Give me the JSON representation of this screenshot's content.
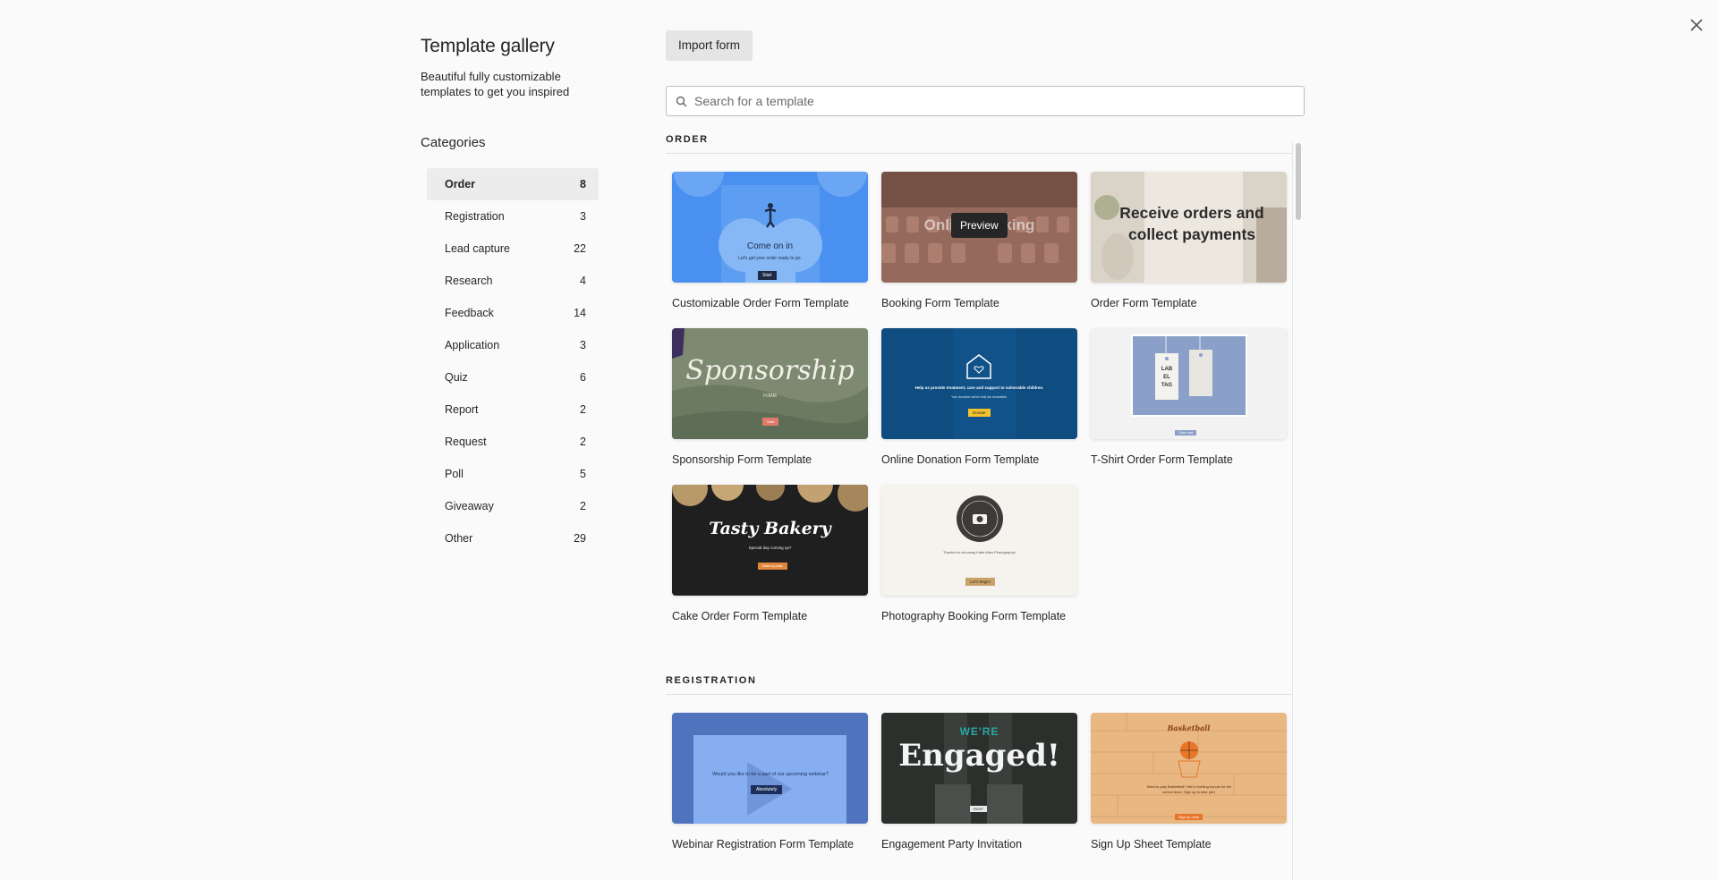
{
  "gallery": {
    "title": "Template gallery",
    "subtitle": "Beautiful fully customizable templates to get you inspired",
    "categories_heading": "Categories",
    "categories": [
      {
        "label": "Order",
        "count": "8",
        "active": true
      },
      {
        "label": "Registration",
        "count": "3"
      },
      {
        "label": "Lead capture",
        "count": "22"
      },
      {
        "label": "Research",
        "count": "4"
      },
      {
        "label": "Feedback",
        "count": "14"
      },
      {
        "label": "Application",
        "count": "3"
      },
      {
        "label": "Quiz",
        "count": "6"
      },
      {
        "label": "Report",
        "count": "2"
      },
      {
        "label": "Request",
        "count": "2"
      },
      {
        "label": "Poll",
        "count": "5"
      },
      {
        "label": "Giveaway",
        "count": "2"
      },
      {
        "label": "Other",
        "count": "29"
      }
    ]
  },
  "toolbar": {
    "import_label": "Import form",
    "close_icon": "close-icon"
  },
  "search": {
    "placeholder": "Search for a template",
    "value": ""
  },
  "sections": [
    {
      "label": "ORDER",
      "templates": [
        {
          "title": "Customizable Order Form Template",
          "thumb_text": "Come on in",
          "thumb_sub": "Let's get your order ready to go.",
          "thumb_btn": "Start"
        },
        {
          "title": "Booking Form Template",
          "thumb_text": "Online booking",
          "tooltip": "Preview"
        },
        {
          "title": "Order Form Template",
          "thumb_text": "Receive orders and collect payments"
        },
        {
          "title": "Sponsorship Form Template",
          "thumb_text": "Sponsorship",
          "thumb_sub": "FORM",
          "thumb_btn": "Start"
        },
        {
          "title": "Online Donation Form Template",
          "thumb_text": "Help us provide treatment, care and support to vulnerable children.",
          "thumb_sub": "Your donation will be fully tax deductible.",
          "thumb_btn": "Donate"
        },
        {
          "title": "T-Shirt Order Form Template",
          "thumb_text": "LAB EL TAG",
          "thumb_btn": "Order now"
        },
        {
          "title": "Cake Order Form Template",
          "thumb_text": "Tasty Bakery",
          "thumb_sub": "Special day coming up?",
          "thumb_btn": "Make my cake"
        },
        {
          "title": "Photography Booking Form Template",
          "thumb_text": "Thanks for choosing Katie Allen Photography!",
          "thumb_btn": "Let's begin!"
        }
      ]
    },
    {
      "label": "REGISTRATION",
      "templates": [
        {
          "title": "Webinar Registration Form Template",
          "thumb_text": "Would you like to be a part of our upcoming webinar?",
          "thumb_btn": "Absolutely"
        },
        {
          "title": "Engagement Party Invitation",
          "thumb_text": "Engaged!",
          "thumb_sub": "WE'RE",
          "thumb_btn": "RSVP"
        },
        {
          "title": "Sign Up Sheet Template",
          "thumb_text": "Basketball",
          "thumb_sub": "Want to play Basketball? We're holding tryouts for the school team. Sign up to take part.",
          "thumb_btn": "Sign up now!"
        }
      ]
    }
  ],
  "colors": {
    "active_category_bg": "#ececec",
    "import_button_bg": "#e5e5e5",
    "text": "#262627"
  }
}
